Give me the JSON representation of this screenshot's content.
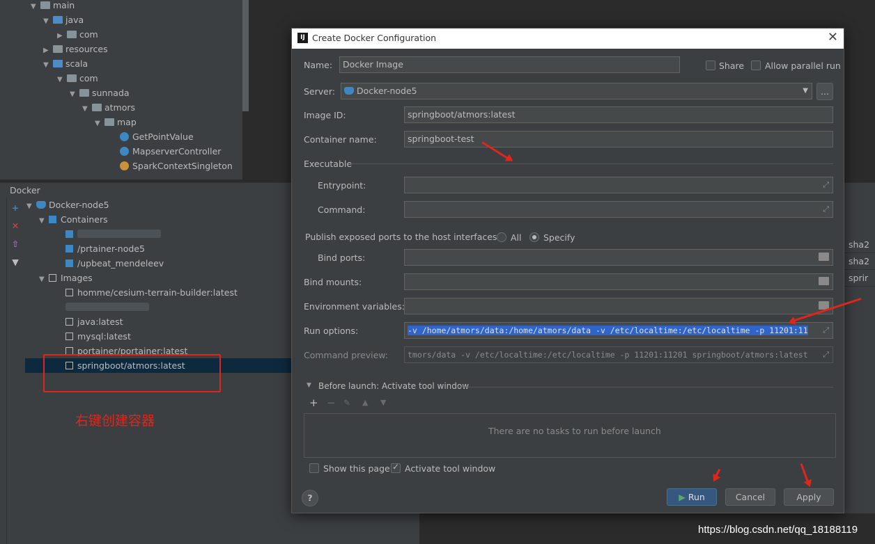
{
  "project_tree": {
    "items": [
      {
        "label": "main"
      },
      {
        "label": "java"
      },
      {
        "label": "com"
      },
      {
        "label": "resources"
      },
      {
        "label": "scala"
      },
      {
        "label": "com"
      },
      {
        "label": "sunnada"
      },
      {
        "label": "atmors"
      },
      {
        "label": "map"
      },
      {
        "label": "GetPointValue"
      },
      {
        "label": "MapserverController"
      },
      {
        "label": "SparkContextSingleton"
      }
    ]
  },
  "docker_panel": {
    "title": "Docker",
    "tree": {
      "root": "Docker-node5",
      "containers_label": "Containers",
      "containers": [
        "/prtainer-node5",
        "/upbeat_mendeleev"
      ],
      "images_label": "Images",
      "images": [
        "homme/cesium-terrain-builder:latest",
        "java:latest",
        "mysql:latest",
        "portainer/portainer:latest",
        "springboot/atmors:latest"
      ]
    },
    "annotation": "右键创建容器",
    "right_table_cells": [
      "sha2",
      "sha2",
      "sprir"
    ]
  },
  "dialog": {
    "title": "Create Docker Configuration",
    "name_label": "Name:",
    "name_value": "Docker Image",
    "share_label": "Share",
    "allow_parallel_label": "Allow parallel run",
    "server_label": "Server:",
    "server_value": "Docker-node5",
    "server_more": "...",
    "image_id_label": "Image ID:",
    "image_id_value": "springboot/atmors:latest",
    "container_name_label": "Container name:",
    "container_name_value": "springboot-test",
    "executable_section": "Executable",
    "entrypoint_label": "Entrypoint:",
    "entrypoint_value": "",
    "command_label": "Command:",
    "command_value": "",
    "publish_ports_label": "Publish exposed ports to the host interfaces:",
    "publish_all": "All",
    "publish_specify": "Specify",
    "bind_ports_label": "Bind ports:",
    "bind_ports_value": "",
    "bind_mounts_label": "Bind mounts:",
    "bind_mounts_value": "",
    "env_vars_label": "Environment variables:",
    "env_vars_value": "",
    "run_options_label": "Run options:",
    "run_options_value": "-v /home/atmors/data:/home/atmors/data -v /etc/localtime:/etc/localtime -p 11201:11",
    "command_preview_label": "Command preview:",
    "command_preview_value": "tmors/data -v /etc/localtime:/etc/localtime -p 11201:11201 springboot/atmors:latest",
    "before_launch_label": "Before launch: Activate tool window",
    "no_tasks_text": "There are no tasks to run before launch",
    "show_this_page_label": "Show this page",
    "activate_tool_window_label": "Activate tool window",
    "run_button": "Run",
    "cancel_button": "Cancel",
    "apply_button": "Apply",
    "help_button": "?",
    "checkboxes": {
      "share": false,
      "allow_parallel": false,
      "show_this_page": false,
      "activate_tool_window": true
    },
    "publish_mode": "Specify"
  },
  "watermark": "https://blog.csdn.net/qq_18188119",
  "colors": {
    "annotation_red": "#e0261b",
    "selection_blue": "#2f65ca",
    "primary_button": "#365880"
  }
}
